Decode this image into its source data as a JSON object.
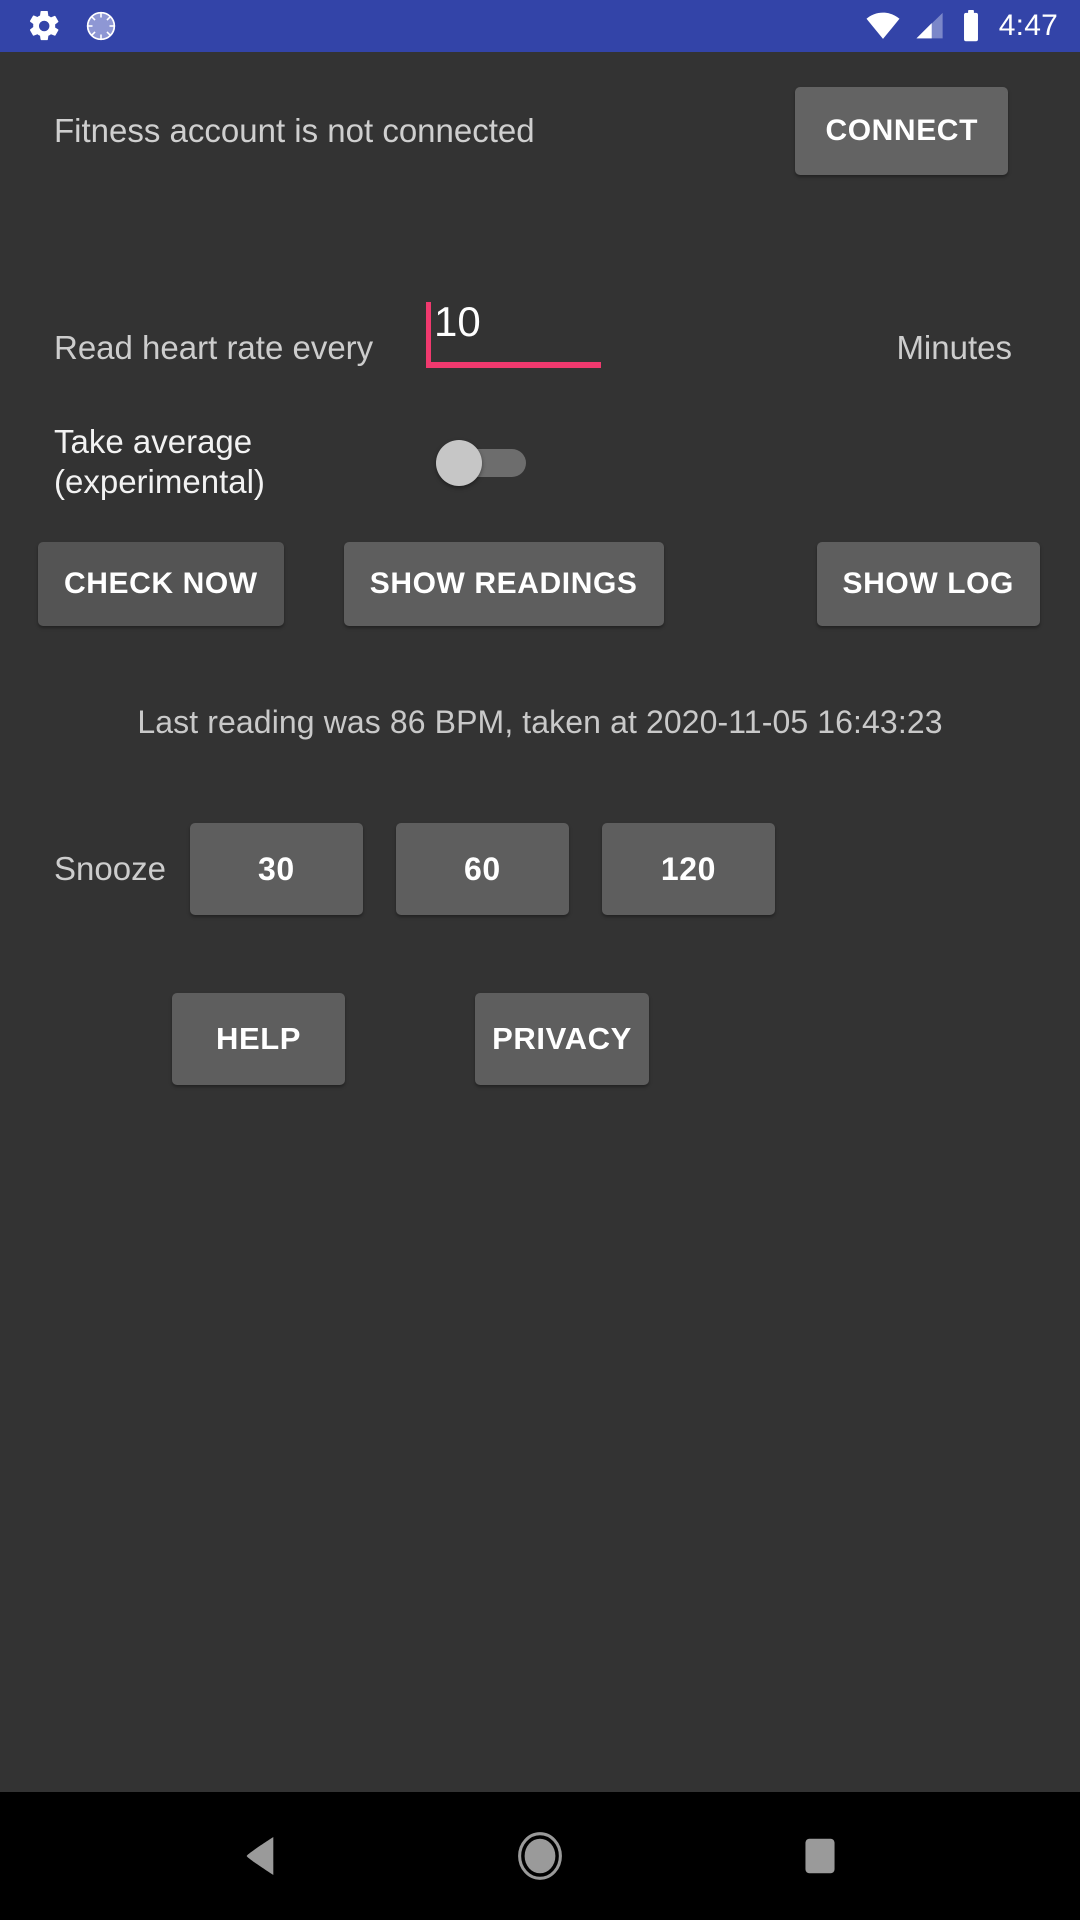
{
  "status_bar": {
    "background_color": "#3344a8",
    "time": "4:47",
    "left_icons": [
      "settings-gear-icon",
      "sync-progress-icon"
    ],
    "right_icons": [
      "wifi-icon",
      "cell-signal-icon",
      "battery-icon"
    ]
  },
  "fitness": {
    "status_text": "Fitness account is not connected",
    "connect_label": "CONNECT"
  },
  "interval": {
    "label": "Read heart rate every",
    "value": "10",
    "unit": "Minutes",
    "accent_color": "#f0396e"
  },
  "average": {
    "label": "Take average (experimental)",
    "enabled": false
  },
  "actions": {
    "check_now_label": "CHECK NOW",
    "show_readings_label": "SHOW READINGS",
    "show_log_label": "SHOW LOG"
  },
  "last_reading": {
    "text": "Last reading was 86 BPM, taken at 2020-11-05 16:43:23",
    "bpm": 86,
    "timestamp": "2020-11-05 16:43:23"
  },
  "snooze": {
    "label": "Snooze",
    "options": [
      "30",
      "60",
      "120"
    ]
  },
  "footer": {
    "help_label": "HELP",
    "privacy_label": "PRIVACY"
  },
  "nav_bar": {
    "back": "back-triangle-icon",
    "home": "home-circle-icon",
    "recents": "recents-square-icon"
  },
  "theme": {
    "app_background": "#333333",
    "button_background": "#5e5e5e",
    "primary_text": "#f2f2f2",
    "secondary_text": "#cdcdcd",
    "nav_background": "#000000"
  }
}
